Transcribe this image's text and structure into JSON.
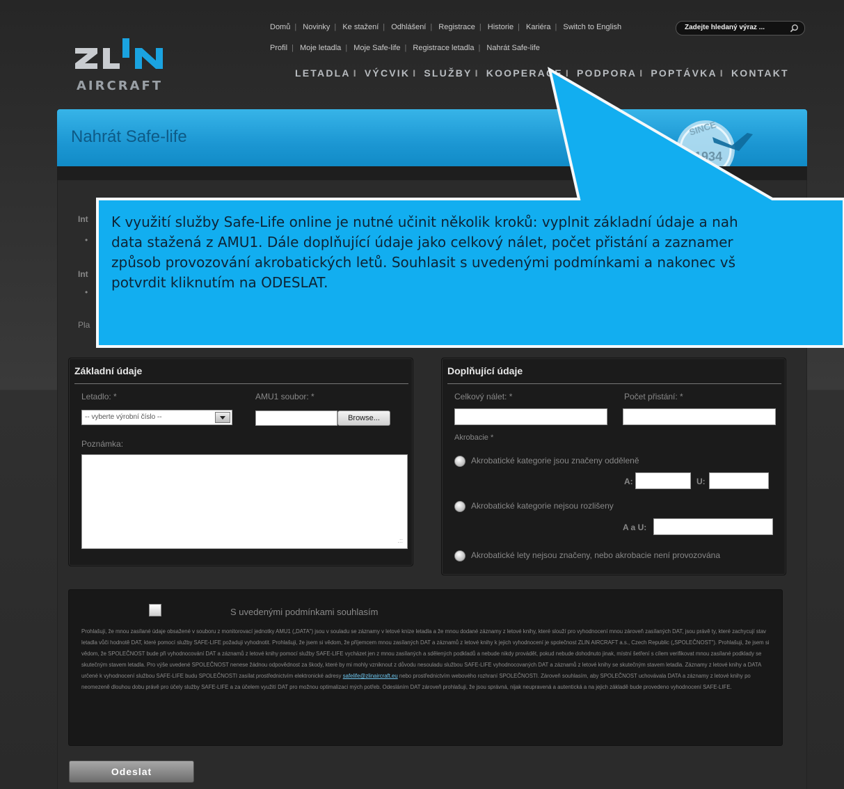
{
  "brand": {
    "logo_word": "ZLIN",
    "logo_sub": "AIRCRAFT"
  },
  "topnav": {
    "row1": [
      "Domů",
      "Novinky",
      "Ke stažení",
      "Odhlášení",
      "Registrace",
      "Historie",
      "Kariéra",
      "Switch to English"
    ],
    "row2": [
      "Profil",
      "Moje letadla",
      "Moje Safe-life",
      "Registrace letadla",
      "Nahrát Safe-life"
    ]
  },
  "search": {
    "placeholder": "Zadejte hledaný výraz ..."
  },
  "mainnav": [
    "LETADLA",
    "VÝCVIK",
    "SLUŽBY",
    "KOOPERACE",
    "PODPORA",
    "POPTÁVKA",
    "KONTAKT"
  ],
  "page": {
    "title": "Nahrát Safe-life",
    "badge_text": "SINCE",
    "badge_year": "1934",
    "intro_fragments": [
      "Int",
      "Int",
      "Pla"
    ]
  },
  "basic": {
    "title": "Základní údaje",
    "aircraft_label": "Letadlo: *",
    "aircraft_select": "-- vyberte výrobní číslo --",
    "amu_label": "AMU1 soubor: *",
    "browse_label": "Browse...",
    "note_label": "Poznámka:"
  },
  "extra": {
    "title": "Doplňující údaje",
    "flight_time_label": "Celkový nálet: *",
    "landings_label": "Počet přistání: *",
    "aerobatics_label": "Akrobacie *",
    "opt1": "Akrobatické kategorie jsou značeny odděleně",
    "a_label": "A:",
    "u_label": "U:",
    "opt2": "Akrobatické kategorie nejsou rozlišeny",
    "au_label": "A a U:",
    "opt3": "Akrobatické lety nejsou značeny, nebo akrobacie není provozována"
  },
  "agreement": {
    "title": "S uvedenými podmínkami souhlasím",
    "text_before": "Prohlašuji, že mnou zasílané údaje obsažené v souboru z monitorovací jednotky AMU1 („DATA\") jsou v souladu se záznamy v letové knize letadla a že mnou dodané záznamy z letové knihy, které slouží pro vyhodnocení mnou zároveň zasílaných DAT, jsou právě ty, které zachycují stav letadla vůči hodnotě DAT, které pomocí služby SAFE-LIFE požaduji vyhodnotit. Prohlašuji, že jsem si vědom, že příjemcem mnou zasílaných DAT a záznamů z letové knihy k jejich vyhodnocení je společnost ZLIN AIRCRAFT a.s., Czech Republic („SPOLEČNOST\"). Prohlašuji, že jsem si vědom, že SPOLEČNOST bude při vyhodnocování DAT a záznamů z letové knihy pomocí služby SAFE-LIFE vycházet jen z mnou zasílaných a sdělených podkladů a nebude nikdy provádět, pokud nebude dohodnuto jinak, místní šetření s cílem verifikovat mnou zasílané podklady se skutečným stavem letadla. Pro výše uvedené SPOLEČNOST nenese žádnou odpovědnost za škody, které by mi mohly vzniknout z důvodu nesouladu službou SAFE-LIFE vyhodnocovaných DAT a záznamů z letové knihy se skutečným stavem letadla. Záznamy z letové knihy a DATA určené k vyhodnocení službou SAFE-LIFE budu SPOLEČNOSTI zasílat prostřednictvím elektronické adresy",
    "email": "safelife@zlinaircraft.eu",
    "text_after": "nebo prostřednictvím webového rozhraní SPOLEČNOSTI. Zároveň souhlasím, aby SPOLEČNOST uchovávala DATA a záznamy z letové knihy po neomezeně dlouhou dobu právě pro účely služby SAFE-LIFE a za účelem využití DAT pro možnou optimalizaci mých potřeb. Odesláním DAT zároveň prohlašuji, že jsou správná, nijak neupravená a autentická a na jejich základě bude provedeno vyhodnocení SAFE-LIFE."
  },
  "submit_label": "Odeslat",
  "callout": {
    "lines": [
      "K využití služby Safe-Life online je nutné učinit několik kroků: vyplnit základní údaje a nah",
      "data stažená z AMU1. Dále doplňující údaje jako celkový nálet, počet přistání a zaznamer",
      "způsob provozování akrobatických letů. Souhlasit s uvedenými podmínkami a nakonec vš",
      "potvrdit kliknutím na ODESLAT."
    ],
    "fill": "#12aef0"
  }
}
